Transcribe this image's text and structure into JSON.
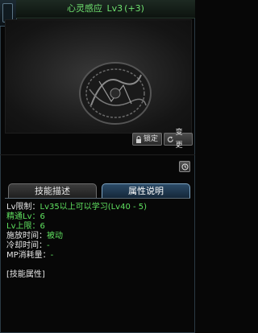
{
  "header": {
    "skill_name": "心灵感应",
    "level": "Lv3",
    "bonus": "(+3)"
  },
  "buttons": {
    "lock": "锁定",
    "change": "变更"
  },
  "tabs": [
    {
      "label": "技能描述",
      "active": false
    },
    {
      "label": "属性说明",
      "active": true
    }
  ],
  "attributes": {
    "level_limit_label": "Lv限制：",
    "level_limit_value": "Lv35以上可以学习(Lv40 - 5)",
    "mastery_label": "精通Lv：",
    "mastery_value": "6",
    "max_label": "Lv上限：",
    "max_value": "6",
    "cast_label": "施放时间：",
    "cast_value": "被动",
    "cooldown_label": "冷却时间：",
    "cooldown_value": "-",
    "mp_label": "MP消耗量：",
    "mp_value": "-",
    "section_title": "[技能属性]"
  },
  "colors": {
    "title_green": "#6fe06f",
    "value_green": "#5fe05f",
    "active_tab": "#2b4a66"
  }
}
